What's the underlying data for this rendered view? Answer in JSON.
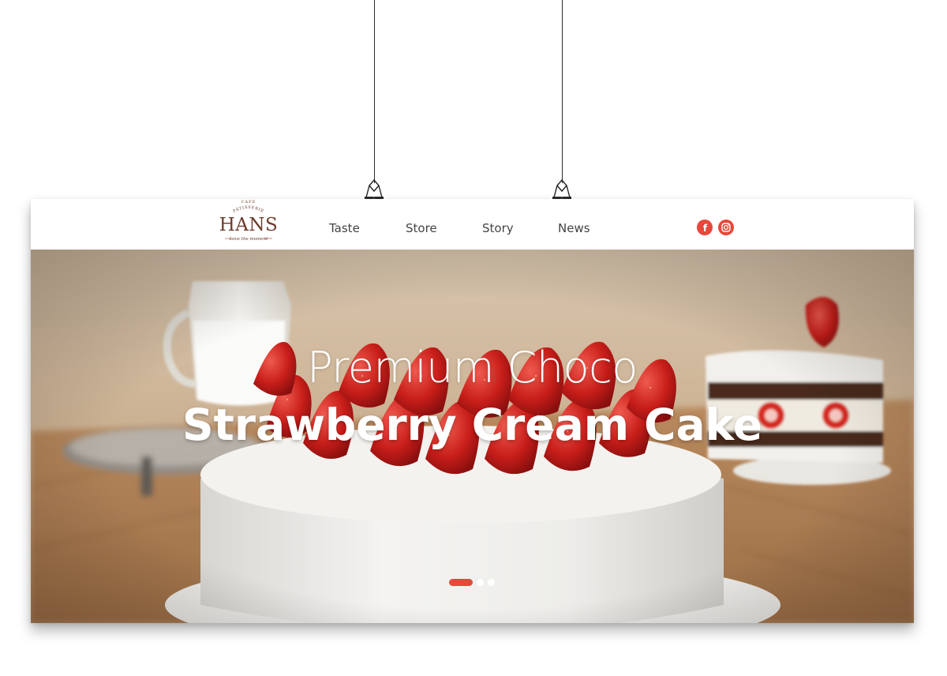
{
  "brand": {
    "top": "CAFE",
    "arc": "PÂTISSERIE",
    "name": "HANS",
    "tagline": "Love the moment"
  },
  "nav": {
    "items": [
      {
        "label": "Taste"
      },
      {
        "label": "Store"
      },
      {
        "label": "Story"
      },
      {
        "label": "News"
      }
    ]
  },
  "social": [
    {
      "icon": "facebook-icon",
      "glyph": "f"
    },
    {
      "icon": "instagram-icon"
    }
  ],
  "hero": {
    "line1": "Premium Choco",
    "line2": "Strawberry Cream Cake",
    "slides_total": 3,
    "active_slide": 1
  },
  "colors": {
    "accent": "#e8473a",
    "logo_brown": "#6b3a2a",
    "menu_text": "#444444"
  }
}
